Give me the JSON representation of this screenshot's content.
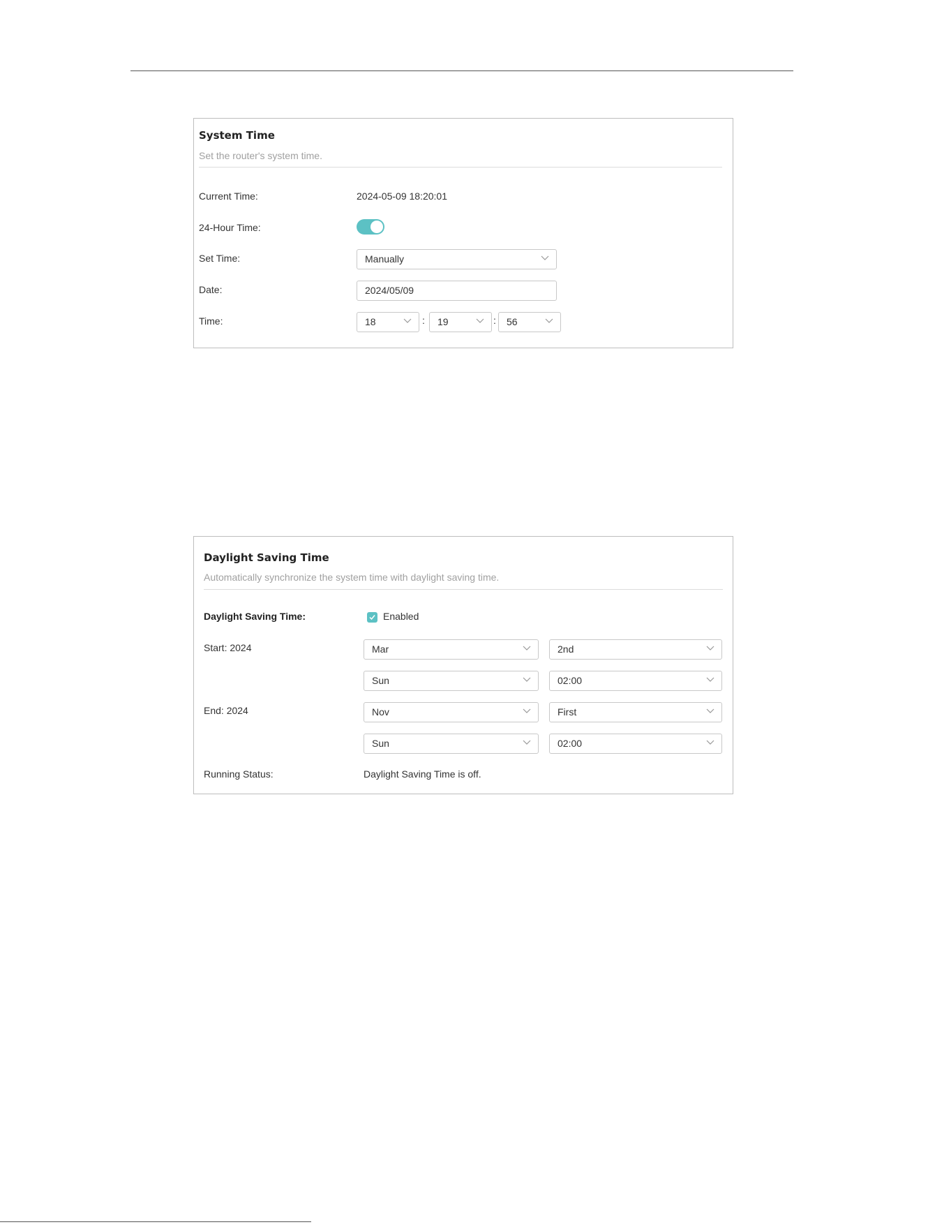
{
  "system_time": {
    "title": "System Time",
    "subtitle": "Set the router's system time.",
    "current_time_label": "Current Time:",
    "current_time_value": "2024-05-09 18:20:01",
    "hour24_label": "24-Hour Time:",
    "hour24_on": true,
    "set_time_label": "Set Time:",
    "set_time_value": "Manually",
    "date_label": "Date:",
    "date_value": "2024/05/09",
    "time_label": "Time:",
    "time_hour": "18",
    "time_minute": "19",
    "time_second": "56",
    "time_separator": ":"
  },
  "daylight_saving": {
    "title": "Daylight Saving Time",
    "subtitle": "Automatically synchronize the system time with daylight saving time.",
    "dst_label": "Daylight Saving Time:",
    "enabled_label": "Enabled",
    "enabled_checked": true,
    "start_label": "Start: 2024",
    "start_month": "Mar",
    "start_week": "2nd",
    "start_day": "Sun",
    "start_time": "02:00",
    "end_label": "End: 2024",
    "end_month": "Nov",
    "end_week": "First",
    "end_day": "Sun",
    "end_time": "02:00",
    "running_status_label": "Running Status:",
    "running_status_value": "Daylight Saving Time is off."
  },
  "colors": {
    "accent": "#5cc1c4",
    "border": "#c8c8c8",
    "subtitle": "#a0a0a0"
  }
}
